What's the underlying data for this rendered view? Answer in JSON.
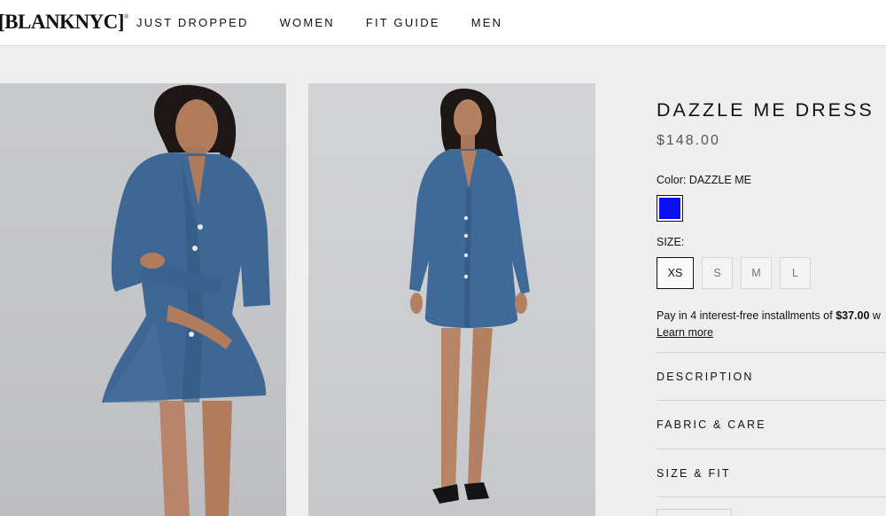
{
  "brand": {
    "logo_text": "[BLANKNYC]",
    "logo_mark": "®"
  },
  "nav": {
    "items": [
      {
        "label": "JUST DROPPED"
      },
      {
        "label": "WOMEN"
      },
      {
        "label": "FIT GUIDE"
      },
      {
        "label": "MEN"
      }
    ]
  },
  "product": {
    "title": "DAZZLE ME DRESS",
    "price": "$148.00",
    "color_label": "Color: DAZZLE ME",
    "swatch_color": "#0a0ef5",
    "size_label": "SIZE:",
    "sizes": [
      "XS",
      "S",
      "M",
      "L"
    ],
    "selected_size": "XS",
    "installments_prefix": "Pay in 4 interest-free installments of ",
    "installments_amount": "$37.00",
    "installments_suffix": " w",
    "learn_more": "Learn more",
    "accordions": [
      {
        "label": "DESCRIPTION"
      },
      {
        "label": "FABRIC & CARE"
      },
      {
        "label": "SIZE & FIT"
      }
    ]
  },
  "colors": {
    "denim": "#3d6591",
    "background": "#efefef"
  }
}
